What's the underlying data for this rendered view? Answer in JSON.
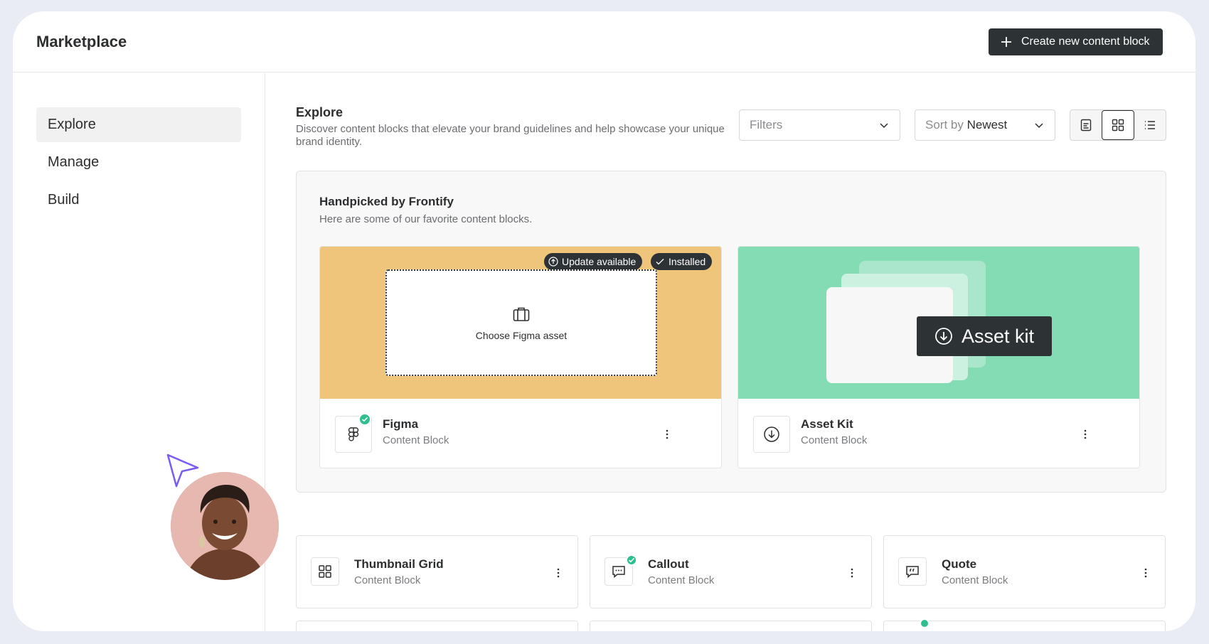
{
  "app": {
    "title": "Marketplace",
    "create_button_label": "Create new content block"
  },
  "sidebar": {
    "items": [
      {
        "label": "Explore",
        "active": true
      },
      {
        "label": "Manage",
        "active": false
      },
      {
        "label": "Build",
        "active": false
      }
    ]
  },
  "explore": {
    "title": "Explore",
    "description": "Discover content blocks that elevate your brand guidelines and help showcase your unique brand identity.",
    "filters_placeholder": "Filters",
    "sort_prefix": "Sort by",
    "sort_value": "Newest",
    "view_modes": [
      "document",
      "grid",
      "list"
    ],
    "active_view": "grid"
  },
  "handpicked": {
    "title": "Handpicked by Frontify",
    "subtitle": "Here are some of our favorite content blocks.",
    "cards": [
      {
        "name": "Figma",
        "type": "Content Block",
        "badge_update": "Update available",
        "badge_installed": "Installed",
        "preview_text": "Choose Figma asset",
        "installed": true,
        "preview_color": "#eec57b"
      },
      {
        "name": "Asset Kit",
        "type": "Content Block",
        "preview_text": "Asset kit",
        "installed": false,
        "preview_color": "#83dcb4"
      }
    ]
  },
  "blocks": [
    {
      "name": "Thumbnail Grid",
      "type": "Content Block",
      "icon": "grid-icon",
      "installed": false
    },
    {
      "name": "Callout",
      "type": "Content Block",
      "icon": "chat-icon",
      "installed": true
    },
    {
      "name": "Quote",
      "type": "Content Block",
      "icon": "quote-icon",
      "installed": false
    }
  ],
  "colors": {
    "dark": "#2d3235",
    "accent_green": "#2fbf8e",
    "figma_yellow": "#eec57b",
    "asset_green": "#83dcb4",
    "cursor_purple": "#7b5cf0"
  }
}
